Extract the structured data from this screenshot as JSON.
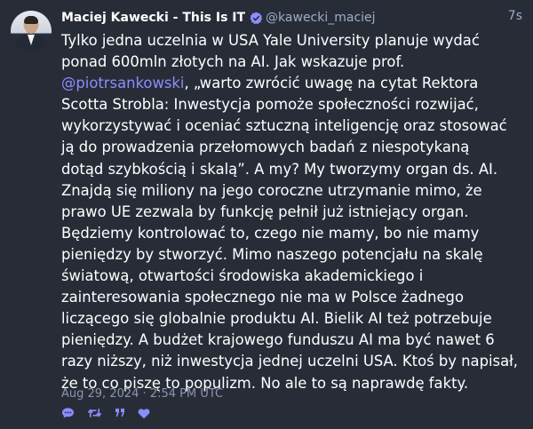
{
  "author": {
    "display_name": "Maciej Kawecki - This Is IT",
    "handle": "@kawecki_maciej",
    "verified_icon": "verified-badge-icon"
  },
  "post": {
    "relative_time": "7s",
    "lines": [
      {
        "text": "Tylko jedna uczelnia w USA Yale University planuje wydać"
      },
      {
        "text": "ponad 600mln złotych na AI. Jak wskazuje prof."
      },
      {
        "mention": "@piotrsankowski",
        "text": ", „warto zwrócić uwagę na cytat Rektora"
      },
      {
        "text": "Scotta Strobla: Inwestycja pomoże społeczności rozwijać,"
      },
      {
        "text": "wykorzystywać i oceniać sztuczną inteligencję oraz stosować"
      },
      {
        "text": "ją do prowadzenia przełomowych badań z niespotykaną"
      },
      {
        "text": "dotąd szybkością i skalą”. A my? My tworzymy organ ds. AI."
      },
      {
        "text": "Znajdą się miliony na jego coroczne utrzymanie mimo, że"
      },
      {
        "text": "prawo UE zezwala by funkcję pełnił już istniejący organ."
      },
      {
        "text": "Będziemy kontrolować to, czego nie mamy, bo nie mamy"
      },
      {
        "text": "pieniędzy by stworzyć. Mimo naszego potencjału na skalę"
      },
      {
        "text": "światową, otwartości środowiska akademickiego i"
      },
      {
        "text": "zainteresowania społecznego nie ma w Polsce żadnego"
      },
      {
        "text": "liczącego się globalnie produktu AI. Bielik AI też potrzebuje"
      },
      {
        "text": "pieniędzy. A budżet krajowego funduszu AI ma być nawet 6"
      },
      {
        "text": "razy niższy, niż inwestycja jednej uczelni USA. Ktoś by napisał,"
      },
      {
        "text": "że to co piszę to populizm. No ale to są naprawdę fakty."
      }
    ],
    "timestamp": "Aug 29, 2024 · 2:54 PM UTC"
  },
  "actions": [
    {
      "icon": "reply-icon"
    },
    {
      "icon": "boost-icon"
    },
    {
      "icon": "quote-icon"
    },
    {
      "icon": "favourite-icon"
    }
  ],
  "colors": {
    "background": "#282c37",
    "text": "#ffffff",
    "muted": "#9baec8",
    "accent": "#8c8dff"
  }
}
